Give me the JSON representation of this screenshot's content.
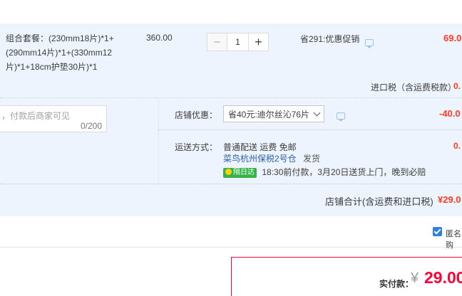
{
  "item": {
    "spec": "组合套餐：(230mm18片)*1+(290mm14片)*1+(330mm12片)*1+18cm护垫30片)*1",
    "unit_price": "360.00",
    "quantity": "1",
    "minus": "−",
    "plus": "+",
    "promo": "省291:优惠促销",
    "subtotal": "69.0",
    "tax_label": "进口税（含运费税款）",
    "tax_value": "0."
  },
  "shop": {
    "message_placeholder": "，付款后商家可见",
    "message_count": "0/200",
    "discount_label": "店铺优惠：",
    "discount_selected": "省40元:迪尔丝沁76片",
    "discount_value": "-40.0",
    "shipping_label": "运送方式：",
    "shipping_method": "普通配送 运费 免邮",
    "shipping_value": "0.",
    "warehouse": "菜鸟杭州保税2号仓",
    "warehouse_suffix": "发货",
    "badge": "隔日达",
    "delivery_note": "18:30前付款，3月20日送货上门，晚到必赔",
    "total_label": "店铺合计(含运费和进口税)",
    "total_value": "¥29.0"
  },
  "anonymous": {
    "label": "匿名购"
  },
  "payment": {
    "label": "实付款：",
    "currency": "¥",
    "amount": "29.00"
  },
  "colors": {
    "accent_red": "#ff0036",
    "price_orange": "#ff3a1f",
    "section_bg": "#eef4fd",
    "checkbox_blue": "#2f7fe0",
    "badge_green": "#35b34a"
  }
}
